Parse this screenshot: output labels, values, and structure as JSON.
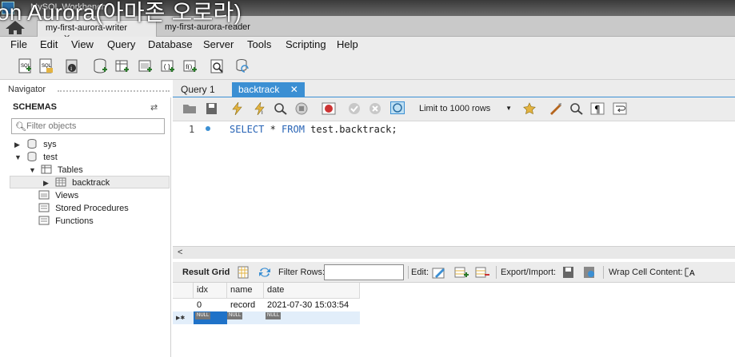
{
  "window": {
    "app_title": "MySQL Workbench",
    "overlay_caption": "on Aurora(아마존 오로라)"
  },
  "connection_tabs": [
    {
      "label": "my-first-aurora-writer",
      "close": "✕",
      "active": true
    },
    {
      "label": "my-first-aurora-reader",
      "close": "✕",
      "active": false
    }
  ],
  "menu": [
    "File",
    "Edit",
    "View",
    "Query",
    "Database",
    "Server",
    "Tools",
    "Scripting",
    "Help"
  ],
  "navigator": {
    "title": "Navigator",
    "schemas_label": "SCHEMAS",
    "filter_placeholder": "Filter objects",
    "tree": {
      "sys": "sys",
      "test": "test",
      "tables": "Tables",
      "backtrack": "backtrack",
      "views": "Views",
      "procedures": "Stored Procedures",
      "functions": "Functions"
    }
  },
  "query_tabs": [
    {
      "label": "Query 1",
      "active": false
    },
    {
      "label": "backtrack",
      "close": "✕",
      "active": true
    }
  ],
  "editor_toolbar": {
    "limit_label": "Limit to 1000 rows"
  },
  "editor": {
    "line_number": "1",
    "code_kw1": "SELECT",
    "code_mid": " * ",
    "code_kw2": "FROM",
    "code_rest": " test.backtrack;"
  },
  "result_toolbar": {
    "result_grid": "Result Grid",
    "filter_rows": "Filter Rows:",
    "edit": "Edit:",
    "export_import": "Export/Import:",
    "wrap": "Wrap Cell Content:"
  },
  "grid": {
    "columns": [
      "idx",
      "name",
      "date"
    ],
    "rows": [
      [
        "0",
        "record",
        "2021-07-30 15:03:54"
      ]
    ],
    "null_label": "NULL"
  },
  "colors": {
    "accent": "#3b8fd3",
    "keyword": "#2763b5"
  }
}
